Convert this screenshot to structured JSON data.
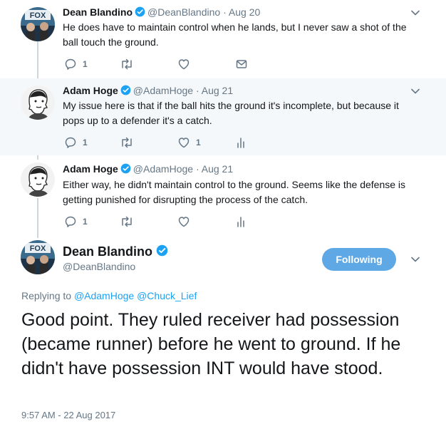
{
  "tweets": [
    {
      "name": "Dean Blandino",
      "handle": "@DeanBlandino",
      "separator": "·",
      "date": "Aug 20",
      "text": "He does have to maintain control when he lands, but I never saw a shot of the ball touch the ground.",
      "reply_count": "1",
      "retweet_count": "",
      "like_count": "",
      "icons": [
        "reply-icon",
        "retweet-icon",
        "heart-icon",
        "mail-icon"
      ]
    },
    {
      "name": "Adam Hoge",
      "handle": "@AdamHoge",
      "separator": "·",
      "date": "Aug 21",
      "text": "My issue here is that if the ball hits the ground it's incomplete, but because it pops up to a defender it's a catch.",
      "reply_count": "1",
      "retweet_count": "",
      "like_count": "1",
      "icons": [
        "reply-icon",
        "retweet-icon",
        "heart-icon",
        "analytics-icon"
      ]
    },
    {
      "name": "Adam Hoge",
      "handle": "@AdamHoge",
      "separator": "·",
      "date": "Aug 21",
      "text": "Either way, he didn't maintain control to the ground. Seems like the defense is getting punished for disrupting the process of the catch.",
      "reply_count": "1",
      "retweet_count": "",
      "like_count": "",
      "icons": [
        "reply-icon",
        "retweet-icon",
        "heart-icon",
        "analytics-icon"
      ]
    }
  ],
  "main_tweet": {
    "name": "Dean Blandino",
    "handle": "@DeanBlandino",
    "follow_label": "Following",
    "replying_prefix": "Replying to",
    "replying_to": [
      "@AdamHoge",
      "@Chuck_Lief"
    ],
    "text": "Good point. They ruled receiver had possession (became runner) before he went to ground. If he didn't have possession INT would have stood.",
    "timestamp": "9:57 AM - 22 Aug 2017"
  },
  "avatar_text": "FOX",
  "colors": {
    "accent": "#1da1f2",
    "follow_button": "#5fa8e6",
    "muted": "#657786",
    "highlight_bg": "#f5f8fa",
    "thread_line": "#ccd6dd"
  }
}
